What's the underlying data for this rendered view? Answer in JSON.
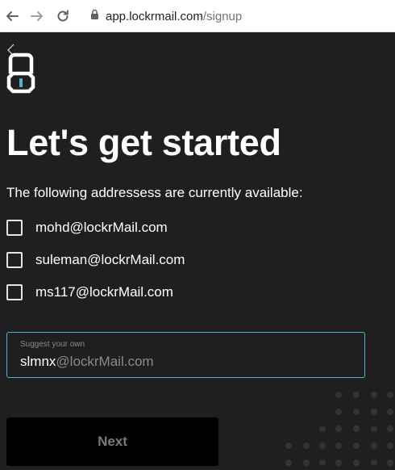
{
  "browser": {
    "url_host": "app.lockrmail.com",
    "url_path": "/signup"
  },
  "page": {
    "title": "Let's get started",
    "subtitle": "The following addressess are currently available:",
    "options": [
      {
        "label": "mohd@lockrMail.com",
        "checked": false
      },
      {
        "label": "suleman@lockrMail.com",
        "checked": false
      },
      {
        "label": "ms117@lockrMail.com",
        "checked": false
      }
    ],
    "suggest": {
      "label": "Suggest your own",
      "typed": "slmnx",
      "domain": "@lockrMail.com"
    },
    "next_label": "Next"
  },
  "colors": {
    "background": "#1f1f1f",
    "accent": "#4fb3d1",
    "text": "#ffffff",
    "muted": "#8a8a8a",
    "button": "#000000"
  }
}
